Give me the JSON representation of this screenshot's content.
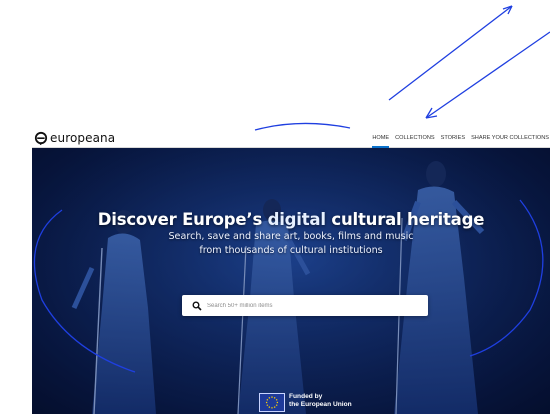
{
  "header": {
    "logo_text": "europeana",
    "nav": [
      {
        "label": "HOME",
        "active": true
      },
      {
        "label": "COLLECTIONS",
        "active": false
      },
      {
        "label": "STORIES",
        "active": false
      },
      {
        "label": "SHARE YOUR COLLECTIONS",
        "active": false
      }
    ]
  },
  "hero": {
    "title_pre": "Discover Europe’s ",
    "title_highlight": "digital",
    "title_post": " cultural heritage",
    "subtitle_line1": "Search, save and share art, books, films and music",
    "subtitle_line2": "from thousands of cultural institutions"
  },
  "search": {
    "placeholder": "Search 50+ million items",
    "value": ""
  },
  "footer_badge": {
    "line1": "Funded by",
    "line2": "the European Union"
  },
  "colors": {
    "accent": "#0a72cc",
    "annotation": "#1f3fe0",
    "hero_overlay": "#0b1e4e"
  },
  "icons": {
    "logo": "europeana-logo-icon",
    "search": "search-icon",
    "flag": "eu-flag-icon"
  }
}
